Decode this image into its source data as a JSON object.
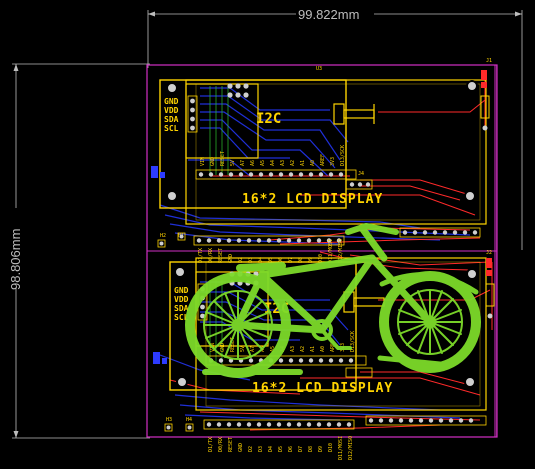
{
  "dimensions": {
    "width_label": "99.822mm",
    "height_label": "98.806mm"
  },
  "top_module": {
    "i2c_pins": [
      "GND",
      "VDD",
      "SDA",
      "SCL"
    ],
    "i2c_label": "I2C",
    "lcd_label": "16*2 LCD DISPLAY",
    "ref_u": "U3",
    "ref_h2": "H2",
    "ref_h1": "H1",
    "ref_j4": "J4",
    "ref_jp": "J1"
  },
  "bottom_module": {
    "i2c_pins": [
      "GND",
      "VDD",
      "SDA",
      "SCL"
    ],
    "i2c_label": "I2C",
    "lcd_label": "16*2 LCD DISPLAY",
    "ref_h3": "H3",
    "ref_h4": "H4",
    "ref_j2": "J2"
  },
  "header_pin_labels": [
    "D1/TX",
    "D0/RX",
    "RESET",
    "GND",
    "D2",
    "D3",
    "D4",
    "D5",
    "D6",
    "D7",
    "D8",
    "D9",
    "D10",
    "D11/MOSI",
    "D12/MISO"
  ],
  "analog_pin_labels": [
    "VIN",
    "GND",
    "RESET",
    "5V",
    "A7",
    "A6",
    "A5",
    "A4",
    "A3",
    "A2",
    "A1",
    "A0",
    "AREF",
    "3V3",
    "D13/SCK"
  ],
  "colors": {
    "board_outline": "#d12fc4",
    "silkscreen": "#ffd400",
    "top_trace": "#ff2a2a",
    "bottom_trace": "#1f2fd6",
    "logo_fill": "#7ddb2a",
    "dimension": "#bdbdbd"
  },
  "logo": {
    "name": "bicycle-logo"
  }
}
